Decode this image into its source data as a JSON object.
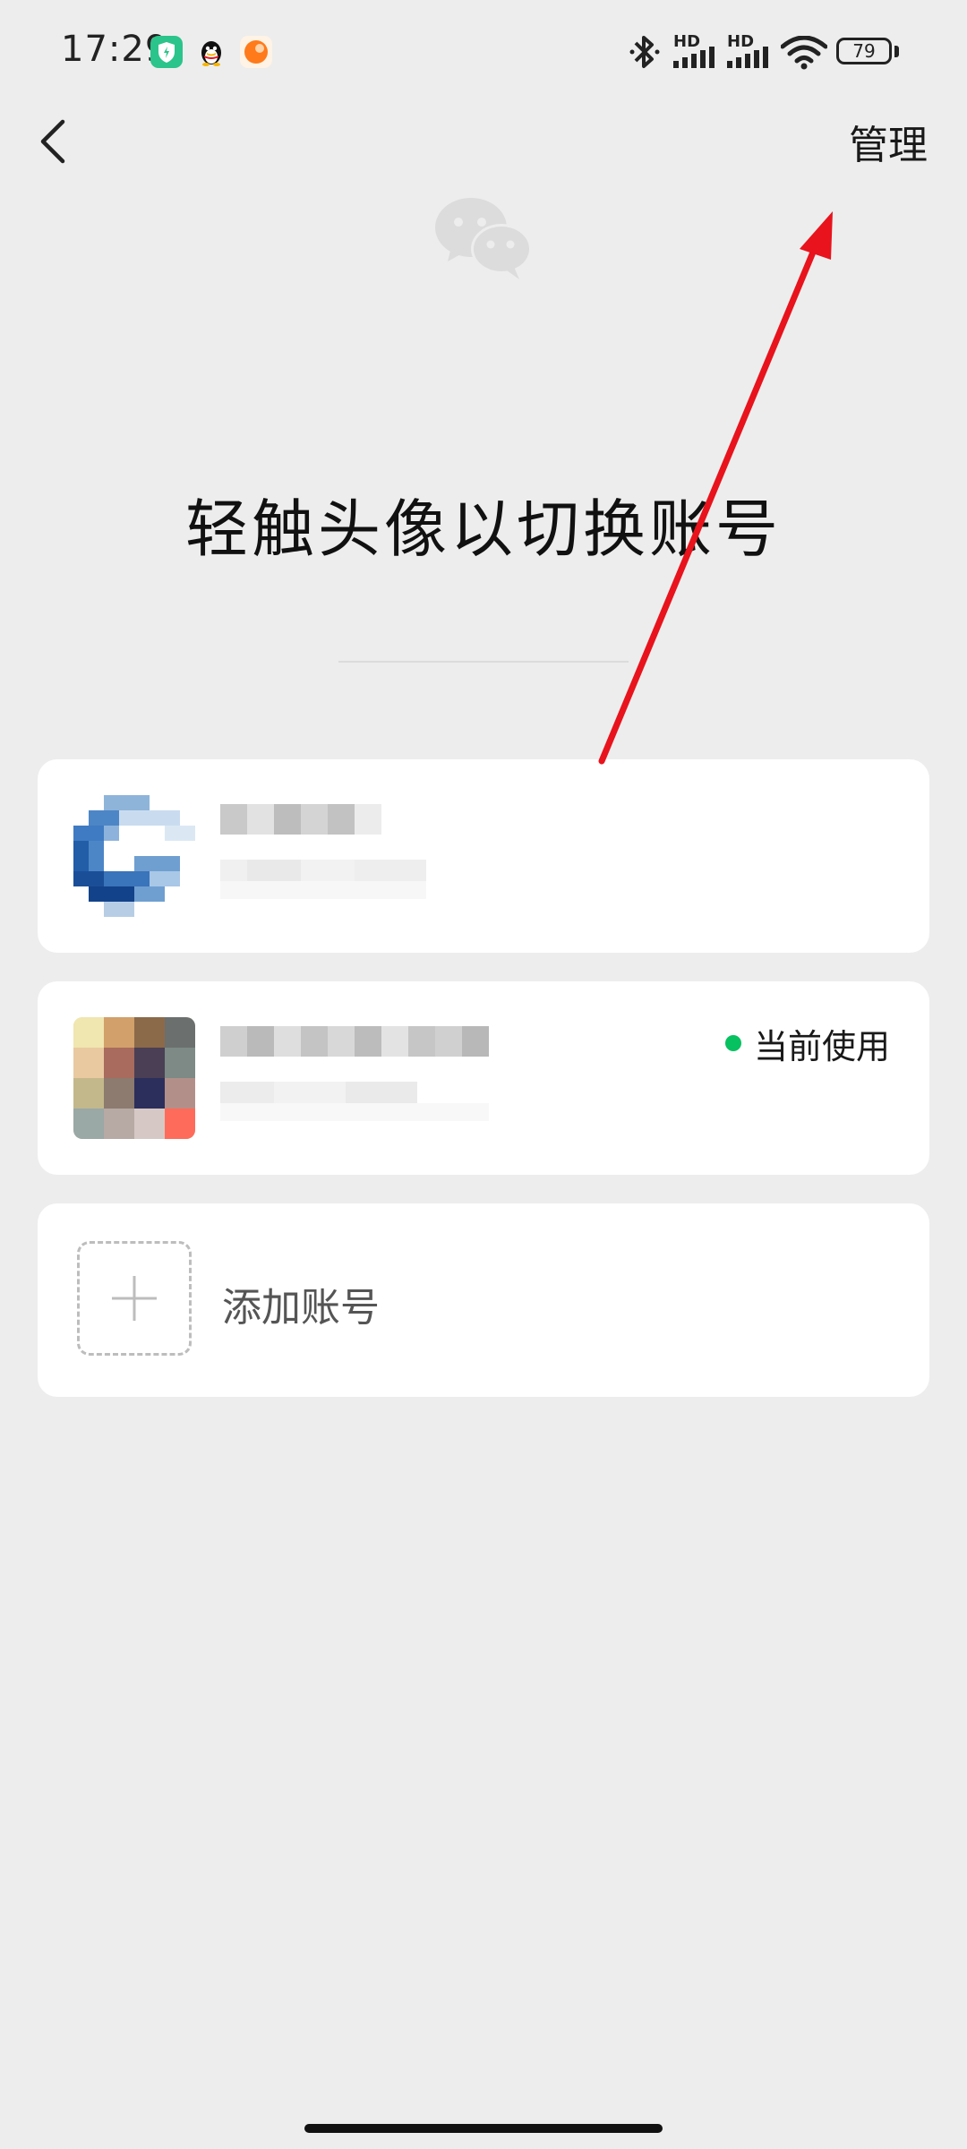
{
  "status_bar": {
    "time": "17:29",
    "battery_level": "79",
    "network_label_1": "HD",
    "network_label_2": "HD",
    "icons": [
      "shield-app-icon",
      "qq-penguin-icon",
      "orange-app-icon",
      "bluetooth-icon",
      "cellular-signal-icon",
      "cellular-signal-icon",
      "wifi-icon",
      "battery-icon"
    ]
  },
  "nav": {
    "back_icon": "chevron-left-icon",
    "manage_label": "管理"
  },
  "header": {
    "logo_icon": "wechat-logo-icon",
    "title": "轻触头像以切换账号"
  },
  "accounts": [
    {
      "avatar": "blurred-avatar-blue",
      "name": "",
      "id": "",
      "current": false
    },
    {
      "avatar": "blurred-avatar-photo",
      "name": "",
      "id": "",
      "current": true,
      "current_label": "当前使用"
    }
  ],
  "add_account": {
    "icon": "plus-icon",
    "label": "添加账号"
  },
  "colors": {
    "background": "#ededed",
    "card": "#ffffff",
    "accent_green": "#07c160",
    "annotation_red": "#e8131c"
  }
}
